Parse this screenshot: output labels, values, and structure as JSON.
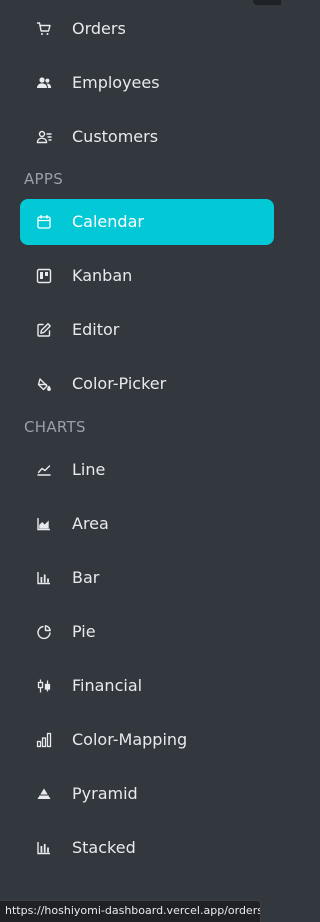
{
  "sidebar": {
    "items_top": [
      {
        "label": "Orders",
        "icon": "cart-icon"
      },
      {
        "label": "Employees",
        "icon": "users-icon"
      },
      {
        "label": "Customers",
        "icon": "contact-list-icon"
      }
    ],
    "apps_title": "APPS",
    "apps": [
      {
        "label": "Calendar",
        "icon": "calendar-icon",
        "active": true
      },
      {
        "label": "Kanban",
        "icon": "kanban-icon"
      },
      {
        "label": "Editor",
        "icon": "edit-icon"
      },
      {
        "label": "Color-Picker",
        "icon": "paint-bucket-icon"
      }
    ],
    "charts_title": "CHARTS",
    "charts": [
      {
        "label": "Line",
        "icon": "line-chart-icon"
      },
      {
        "label": "Area",
        "icon": "area-chart-icon"
      },
      {
        "label": "Bar",
        "icon": "bar-chart-icon"
      },
      {
        "label": "Pie",
        "icon": "pie-chart-icon"
      },
      {
        "label": "Financial",
        "icon": "candlestick-icon"
      },
      {
        "label": "Color-Mapping",
        "icon": "column-chart-icon"
      },
      {
        "label": "Pyramid",
        "icon": "pyramid-icon"
      },
      {
        "label": "Stacked",
        "icon": "stacked-chart-icon"
      }
    ]
  },
  "status_bar": {
    "url": "https://hoshiyomi-dashboard.vercel.app/orders"
  },
  "colors": {
    "background": "#33373e",
    "active": "#03c9d7",
    "text": "#e8eaed",
    "section_title": "#9aa0a6"
  }
}
